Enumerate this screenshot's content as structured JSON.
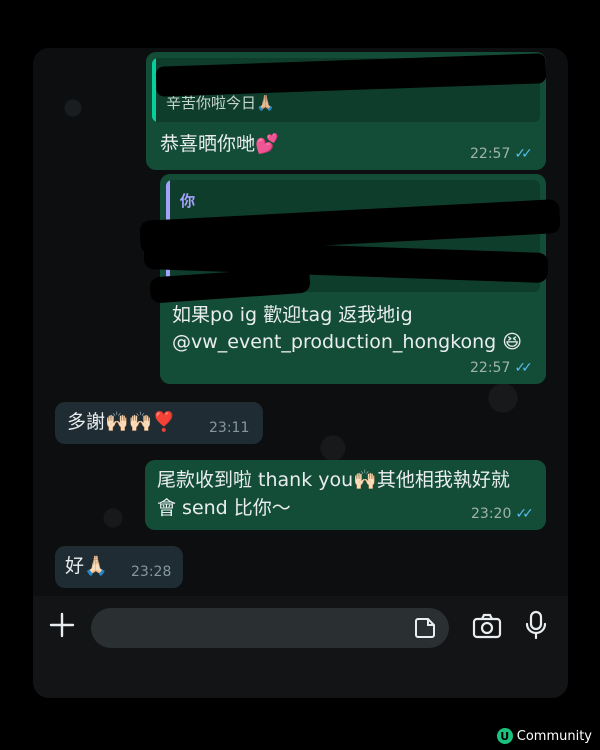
{
  "messages": [
    {
      "id": "m1",
      "direction": "outgoing",
      "quote_text": "辛苦你啦今日🙏🏼",
      "text": "恭喜晒你哋💕",
      "time": "22:57"
    },
    {
      "id": "m2",
      "direction": "outgoing",
      "quote_author": "你",
      "text_line1": "如果po ig 歡迎tag 返我地ig",
      "text_line2": "@vw_event_production_hongkong 😆",
      "time": "22:57"
    },
    {
      "id": "m3",
      "direction": "incoming",
      "text": "多謝🙌🏻🙌🏻❣️",
      "time": "23:11"
    },
    {
      "id": "m4",
      "direction": "outgoing",
      "text_line1": "尾款收到啦 thank you🙌🏻其他相我執好就",
      "text_line2": "會 send 比你～",
      "time": "23:20"
    },
    {
      "id": "m5",
      "direction": "incoming",
      "text": "好🙏🏻",
      "time": "23:28"
    }
  ],
  "read_ticks": "✓✓",
  "composer": {
    "placeholder": "",
    "icons": [
      "plus-icon",
      "sticker-icon",
      "camera-icon",
      "microphone-icon"
    ]
  },
  "watermark": {
    "logo": "U",
    "text": "Community"
  },
  "colors": {
    "outgoing": "#144d37",
    "incoming": "#202c33",
    "tick": "#53bdeb",
    "quote_bar_green": "#06cf9c",
    "quote_bar_purple": "#a5a1ff"
  }
}
